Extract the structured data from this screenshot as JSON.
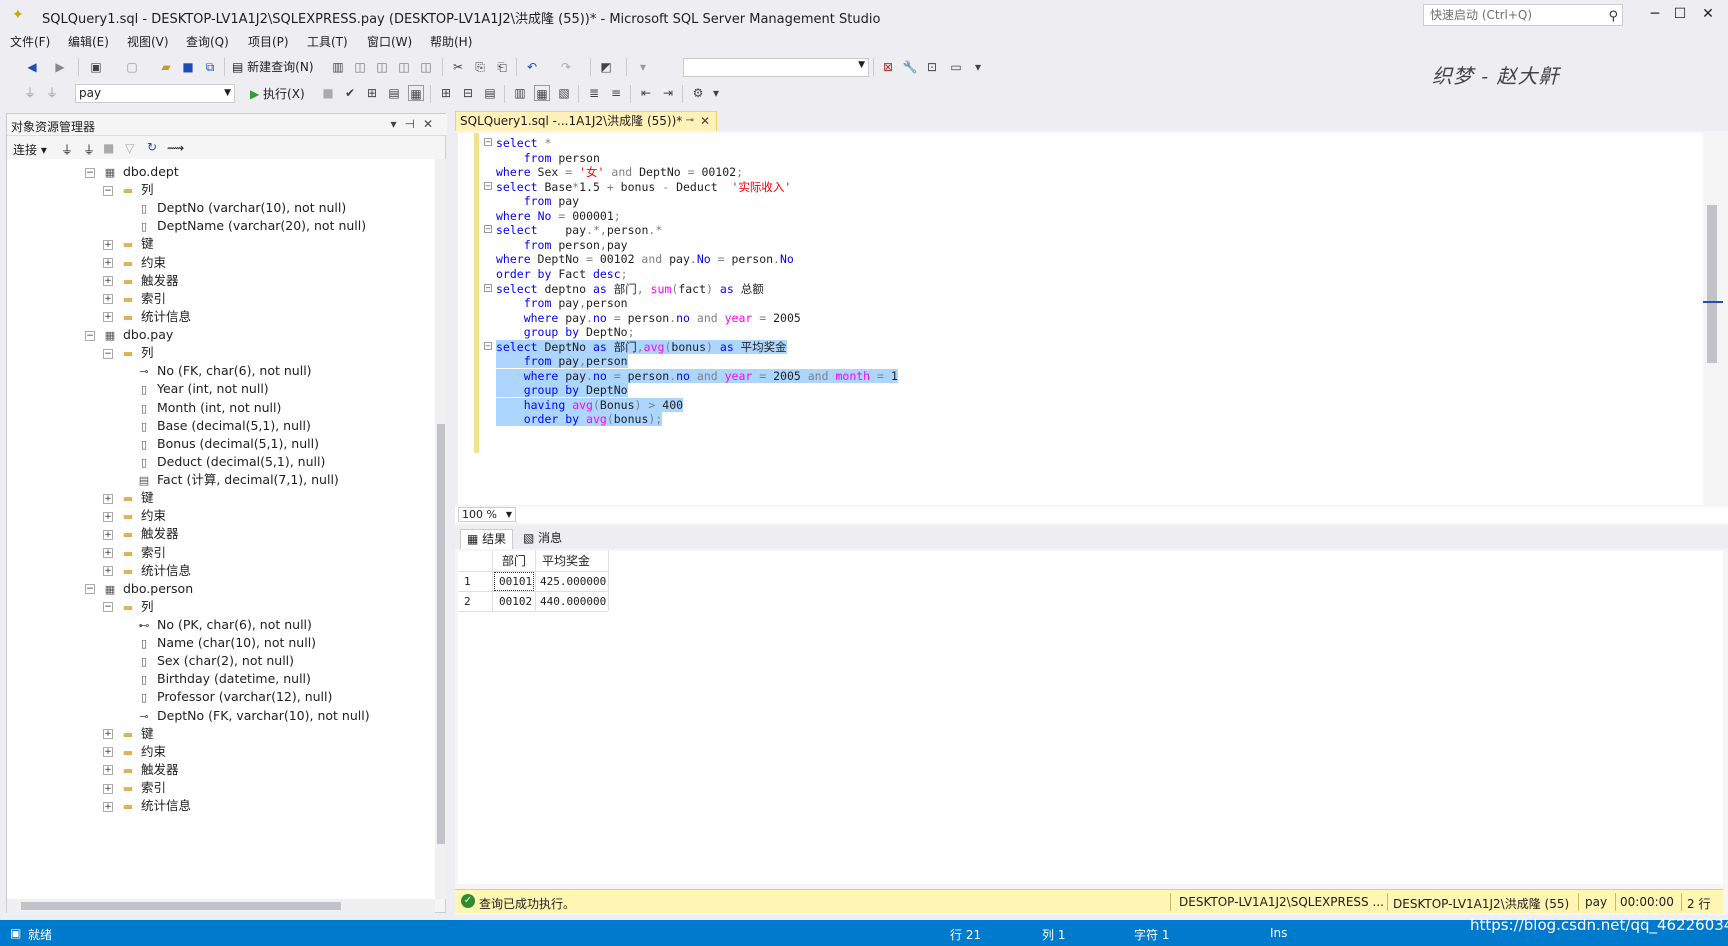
{
  "window": {
    "title": "SQLQuery1.sql - DESKTOP-LV1A1J2\\SQLEXPRESS.pay (DESKTOP-LV1A1J2\\洪成隆 (55))* - Microsoft SQL Server Management Studio",
    "quick_launch_placeholder": "快速启动 (Ctrl+Q)",
    "minimize": "─",
    "maximize": "☐",
    "close": "✕"
  },
  "menu": [
    "文件(F)",
    "编辑(E)",
    "视图(V)",
    "查询(Q)",
    "项目(P)",
    "工具(T)",
    "窗口(W)",
    "帮助(H)"
  ],
  "toolbar": {
    "new_query": "新建查询(N)",
    "database": "pay",
    "execute": "执行(X)"
  },
  "watermark": "织梦 - 赵大鼾",
  "object_explorer": {
    "title": "对象资源管理器",
    "connect": "连接",
    "tree": [
      {
        "label": "dbo.dept",
        "level": 0,
        "kind": "table",
        "exp": "⊟"
      },
      {
        "label": "列",
        "level": 1,
        "kind": "folder",
        "exp": "⊟"
      },
      {
        "label": "DeptNo (varchar(10), not null)",
        "level": 2,
        "kind": "column"
      },
      {
        "label": "DeptName (varchar(20), not null)",
        "level": 2,
        "kind": "column"
      },
      {
        "label": "键",
        "level": 1,
        "kind": "folder",
        "exp": "⊞"
      },
      {
        "label": "约束",
        "level": 1,
        "kind": "folder",
        "exp": "⊞"
      },
      {
        "label": "触发器",
        "level": 1,
        "kind": "folder",
        "exp": "⊞"
      },
      {
        "label": "索引",
        "level": 1,
        "kind": "folder",
        "exp": "⊞"
      },
      {
        "label": "统计信息",
        "level": 1,
        "kind": "folder",
        "exp": "⊞"
      },
      {
        "label": "dbo.pay",
        "level": 0,
        "kind": "table",
        "exp": "⊟"
      },
      {
        "label": "列",
        "level": 1,
        "kind": "folder",
        "exp": "⊟"
      },
      {
        "label": "No (FK, char(6), not null)",
        "level": 2,
        "kind": "fk"
      },
      {
        "label": "Year (int, not null)",
        "level": 2,
        "kind": "column"
      },
      {
        "label": "Month (int, not null)",
        "level": 2,
        "kind": "column"
      },
      {
        "label": "Base (decimal(5,1), null)",
        "level": 2,
        "kind": "column"
      },
      {
        "label": "Bonus (decimal(5,1), null)",
        "level": 2,
        "kind": "column"
      },
      {
        "label": "Deduct (decimal(5,1), null)",
        "level": 2,
        "kind": "column"
      },
      {
        "label": "Fact (计算, decimal(7,1), null)",
        "level": 2,
        "kind": "computed"
      },
      {
        "label": "键",
        "level": 1,
        "kind": "folder",
        "exp": "⊞"
      },
      {
        "label": "约束",
        "level": 1,
        "kind": "folder",
        "exp": "⊞"
      },
      {
        "label": "触发器",
        "level": 1,
        "kind": "folder",
        "exp": "⊞"
      },
      {
        "label": "索引",
        "level": 1,
        "kind": "folder",
        "exp": "⊞"
      },
      {
        "label": "统计信息",
        "level": 1,
        "kind": "folder",
        "exp": "⊞"
      },
      {
        "label": "dbo.person",
        "level": 0,
        "kind": "table",
        "exp": "⊟"
      },
      {
        "label": "列",
        "level": 1,
        "kind": "folder",
        "exp": "⊟"
      },
      {
        "label": "No (PK, char(6), not null)",
        "level": 2,
        "kind": "pk"
      },
      {
        "label": "Name (char(10), not null)",
        "level": 2,
        "kind": "column"
      },
      {
        "label": "Sex (char(2), not null)",
        "level": 2,
        "kind": "column"
      },
      {
        "label": "Birthday (datetime, null)",
        "level": 2,
        "kind": "column"
      },
      {
        "label": "Professor (varchar(12), null)",
        "level": 2,
        "kind": "column"
      },
      {
        "label": "DeptNo (FK, varchar(10), not null)",
        "level": 2,
        "kind": "fk"
      },
      {
        "label": "键",
        "level": 1,
        "kind": "folder",
        "exp": "⊞"
      },
      {
        "label": "约束",
        "level": 1,
        "kind": "folder",
        "exp": "⊞"
      },
      {
        "label": "触发器",
        "level": 1,
        "kind": "folder",
        "exp": "⊞"
      },
      {
        "label": "索引",
        "level": 1,
        "kind": "folder",
        "exp": "⊞"
      },
      {
        "label": "统计信息",
        "level": 1,
        "kind": "folder",
        "exp": "⊞"
      }
    ]
  },
  "editor": {
    "tab_label": "SQLQuery1.sql -...1A1J2\\洪成隆 (55))*",
    "zoom": "100 %",
    "lines": [
      {
        "fold": "⊟",
        "sel": false,
        "parts": [
          [
            "kw",
            "select"
          ],
          [
            "gr",
            " *"
          ]
        ]
      },
      {
        "sel": false,
        "parts": [
          [
            "",
            "    "
          ],
          [
            "kw",
            "from"
          ],
          [
            "",
            " person"
          ]
        ]
      },
      {
        "sel": false,
        "parts": [
          [
            "kw",
            "where"
          ],
          [
            "",
            " Sex "
          ],
          [
            "gr",
            "="
          ],
          [
            "",
            " "
          ],
          [
            "str",
            "'女'"
          ],
          [
            "",
            " "
          ],
          [
            "gr",
            "and"
          ],
          [
            "",
            " DeptNo "
          ],
          [
            "gr",
            "="
          ],
          [
            "",
            " 00102"
          ],
          [
            "gr",
            ";"
          ]
        ]
      },
      {
        "fold": "⊟",
        "sel": false,
        "parts": [
          [
            "kw",
            "select"
          ],
          [
            "",
            " Base"
          ],
          [
            "gr",
            "*"
          ],
          [
            "",
            "1.5 "
          ],
          [
            "gr",
            "+"
          ],
          [
            "",
            " bonus "
          ],
          [
            "gr",
            "-"
          ],
          [
            "",
            " Deduct  "
          ],
          [
            "str",
            "'实际收入'"
          ]
        ]
      },
      {
        "sel": false,
        "parts": [
          [
            "",
            "    "
          ],
          [
            "kw",
            "from"
          ],
          [
            "",
            " pay"
          ]
        ]
      },
      {
        "sel": false,
        "parts": [
          [
            "kw",
            "where"
          ],
          [
            "",
            " "
          ],
          [
            "kw",
            "No"
          ],
          [
            "",
            " "
          ],
          [
            "gr",
            "="
          ],
          [
            "",
            " 000001"
          ],
          [
            "gr",
            ";"
          ]
        ]
      },
      {
        "fold": "⊟",
        "sel": false,
        "parts": [
          [
            "kw",
            "select"
          ],
          [
            "",
            "    pay"
          ],
          [
            "gr",
            "."
          ],
          [
            "gr",
            "*"
          ],
          [
            "gr",
            ","
          ],
          [
            "",
            "person"
          ],
          [
            "gr",
            "."
          ],
          [
            "gr",
            "*"
          ]
        ]
      },
      {
        "sel": false,
        "parts": [
          [
            "",
            "    "
          ],
          [
            "kw",
            "from"
          ],
          [
            "",
            " person"
          ],
          [
            "gr",
            ","
          ],
          [
            "",
            "pay"
          ]
        ]
      },
      {
        "sel": false,
        "parts": [
          [
            "kw",
            "where"
          ],
          [
            "",
            " DeptNo "
          ],
          [
            "gr",
            "="
          ],
          [
            "",
            " 00102 "
          ],
          [
            "gr",
            "and"
          ],
          [
            "",
            " pay"
          ],
          [
            "gr",
            "."
          ],
          [
            "kw",
            "No"
          ],
          [
            "",
            " "
          ],
          [
            "gr",
            "="
          ],
          [
            "",
            " person"
          ],
          [
            "gr",
            "."
          ],
          [
            "kw",
            "No"
          ]
        ]
      },
      {
        "sel": false,
        "parts": [
          [
            "kw",
            "order by"
          ],
          [
            "",
            " Fact "
          ],
          [
            "kw",
            "desc"
          ],
          [
            "gr",
            ";"
          ]
        ]
      },
      {
        "fold": "⊟",
        "sel": false,
        "parts": [
          [
            "kw",
            "select"
          ],
          [
            "",
            " deptno "
          ],
          [
            "kw",
            "as"
          ],
          [
            "",
            " 部门"
          ],
          [
            "gr",
            ","
          ],
          [
            "",
            " "
          ],
          [
            "fn",
            "sum"
          ],
          [
            "gr",
            "("
          ],
          [
            "",
            "fact"
          ],
          [
            "gr",
            ")"
          ],
          [
            "",
            " "
          ],
          [
            "kw",
            "as"
          ],
          [
            "",
            " 总额"
          ]
        ]
      },
      {
        "sel": false,
        "parts": [
          [
            "",
            "    "
          ],
          [
            "kw",
            "from"
          ],
          [
            "",
            " pay"
          ],
          [
            "gr",
            ","
          ],
          [
            "",
            "person"
          ]
        ]
      },
      {
        "sel": false,
        "parts": [
          [
            "",
            "    "
          ],
          [
            "kw",
            "where"
          ],
          [
            "",
            " pay"
          ],
          [
            "gr",
            "."
          ],
          [
            "kw",
            "no"
          ],
          [
            "",
            " "
          ],
          [
            "gr",
            "="
          ],
          [
            "",
            " person"
          ],
          [
            "gr",
            "."
          ],
          [
            "kw",
            "no"
          ],
          [
            "",
            " "
          ],
          [
            "gr",
            "and"
          ],
          [
            "",
            " "
          ],
          [
            "fn",
            "year"
          ],
          [
            "",
            " "
          ],
          [
            "gr",
            "="
          ],
          [
            "",
            " 2005"
          ]
        ]
      },
      {
        "sel": false,
        "parts": [
          [
            "",
            "    "
          ],
          [
            "kw",
            "group by"
          ],
          [
            "",
            " DeptNo"
          ],
          [
            "gr",
            ";"
          ]
        ]
      },
      {
        "fold": "⊟",
        "sel": true,
        "parts": [
          [
            "kw",
            "select"
          ],
          [
            "",
            " DeptNo "
          ],
          [
            "kw",
            "as"
          ],
          [
            "",
            " 部门"
          ],
          [
            "gr",
            ","
          ],
          [
            "fn",
            "avg"
          ],
          [
            "gr",
            "("
          ],
          [
            "",
            "bonus"
          ],
          [
            "gr",
            ")"
          ],
          [
            "",
            " "
          ],
          [
            "kw",
            "as"
          ],
          [
            "",
            " 平均奖金"
          ]
        ]
      },
      {
        "sel": true,
        "parts": [
          [
            "",
            "    "
          ],
          [
            "kw",
            "from"
          ],
          [
            "",
            " pay"
          ],
          [
            "gr",
            ","
          ],
          [
            "",
            "person"
          ]
        ]
      },
      {
        "sel": true,
        "parts": [
          [
            "",
            "    "
          ],
          [
            "kw",
            "where"
          ],
          [
            "",
            " pay"
          ],
          [
            "gr",
            "."
          ],
          [
            "kw",
            "no"
          ],
          [
            "",
            " "
          ],
          [
            "gr",
            "="
          ],
          [
            "",
            " person"
          ],
          [
            "gr",
            "."
          ],
          [
            "kw",
            "no"
          ],
          [
            "",
            " "
          ],
          [
            "gr",
            "and"
          ],
          [
            "",
            " "
          ],
          [
            "fn",
            "year"
          ],
          [
            "",
            " "
          ],
          [
            "gr",
            "="
          ],
          [
            "",
            " 2005 "
          ],
          [
            "gr",
            "and"
          ],
          [
            "",
            " "
          ],
          [
            "fn",
            "month"
          ],
          [
            "",
            " "
          ],
          [
            "gr",
            "="
          ],
          [
            "",
            " 1"
          ]
        ]
      },
      {
        "sel": true,
        "parts": [
          [
            "",
            "    "
          ],
          [
            "kw",
            "group by"
          ],
          [
            "",
            " DeptNo"
          ]
        ]
      },
      {
        "sel": true,
        "parts": [
          [
            "",
            "    "
          ],
          [
            "kw",
            "having"
          ],
          [
            "",
            " "
          ],
          [
            "fn",
            "avg"
          ],
          [
            "gr",
            "("
          ],
          [
            "",
            "Bonus"
          ],
          [
            "gr",
            ")"
          ],
          [
            "",
            " "
          ],
          [
            "gr",
            ">"
          ],
          [
            "",
            " 400"
          ]
        ]
      },
      {
        "sel": true,
        "parts": [
          [
            "",
            "    "
          ],
          [
            "kw",
            "order by"
          ],
          [
            "",
            " "
          ],
          [
            "fn",
            "avg"
          ],
          [
            "gr",
            "("
          ],
          [
            "",
            "bonus"
          ],
          [
            "gr",
            ")"
          ],
          [
            "gr",
            ";"
          ]
        ]
      }
    ]
  },
  "results": {
    "tab_results": "结果",
    "tab_messages": "消息",
    "columns": [
      "部门",
      "平均奖金"
    ],
    "rows": [
      {
        "n": "1",
        "c1": "00101",
        "c2": "425.000000"
      },
      {
        "n": "2",
        "c1": "00102",
        "c2": "440.000000"
      }
    ]
  },
  "query_status": {
    "message": "查询已成功执行。",
    "server": "DESKTOP-LV1A1J2\\SQLEXPRESS ...",
    "login": "DESKTOP-LV1A1J2\\洪成隆 (55)",
    "database": "pay",
    "elapsed": "00:00:00",
    "rows": "2 行"
  },
  "status_bar": {
    "ready": "就绪",
    "line": "行 21",
    "col": "列 1",
    "char": "字符 1",
    "ins": "Ins",
    "csdn": "https://blog.csdn.net/qq_46226034"
  },
  "colors": {
    "accent": "#007acc",
    "selection": "#add6ff",
    "keyword": "#0000ff",
    "string": "#ff0000",
    "function": "#ff00ff"
  }
}
